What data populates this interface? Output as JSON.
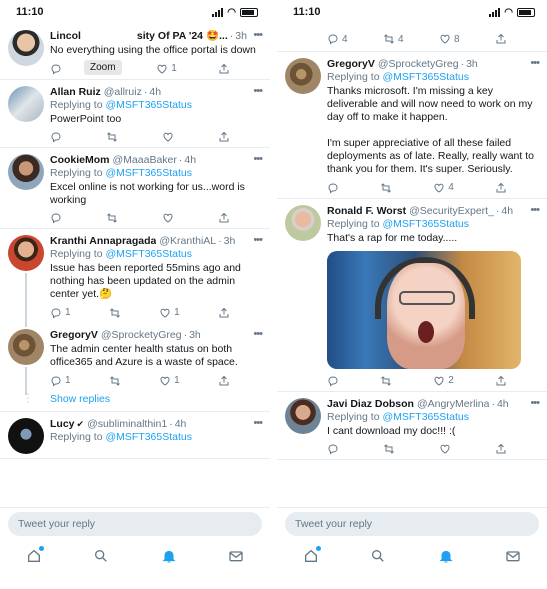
{
  "colors": {
    "accent": "#1da1f2",
    "muted": "#657786",
    "border": "#e6ecf0"
  },
  "left": {
    "status": {
      "time": "11:10"
    },
    "zoom_label": "Zoom",
    "tweets": [
      {
        "name": "Lincol",
        "name_rest": "sity Of PA '24 🤩...",
        "time": "3h",
        "text": "No everything using the office portal is down",
        "reply_count": "",
        "retweet_count": "",
        "like_count": "1"
      },
      {
        "name": "Allan Ruiz",
        "handle": "@allruiz",
        "time": "4h",
        "replying_prefix": "Replying to",
        "replying_to": "@MSFT365Status",
        "text": "PowerPoint too"
      },
      {
        "name": "CookieMom",
        "handle": "@MaaaBaker",
        "time": "4h",
        "replying_prefix": "Replying to",
        "replying_to": "@MSFT365Status",
        "text": "Excel online is not working for us...word is working"
      },
      {
        "name": "Kranthi Annapragada",
        "handle": "@KranthiAL",
        "time": "3h",
        "replying_prefix": "Replying to",
        "replying_to": "@MSFT365Status",
        "text": "Issue has been reported 55mins ago and nothing has been updated on the admin center yet.🤔",
        "reply_count": "1",
        "like_count": "1"
      },
      {
        "name": "GregoryV",
        "handle": "@SprocketyGreg",
        "time": "3h",
        "text": "The admin center health status on both office365 and Azure is a waste of space.",
        "reply_count": "1",
        "like_count": "1"
      },
      {
        "name": "Lucy",
        "handle": "@subliminalthin1",
        "time": "4h",
        "replying_prefix": "Replying to",
        "replying_to": "@MSFT365Status"
      }
    ],
    "show_replies": "Show replies",
    "composer_placeholder": "Tweet your reply"
  },
  "right": {
    "status": {
      "time": "11:10"
    },
    "top_actions": {
      "reply_count": "4",
      "retweet_count": "4",
      "like_count": "8"
    },
    "tweets": [
      {
        "name": "GregoryV",
        "handle": "@SprocketyGreg",
        "time": "3h",
        "replying_prefix": "Replying to",
        "replying_to": "@MSFT365Status",
        "text": "Thanks microsoft.  I'm missing a key deliverable and will now need to work on my day off to make it happen.\n\nI'm super appreciative of all these failed deployments as of late.  Really, really want to thank you for them.  It's super. Seriously.",
        "like_count": "4"
      },
      {
        "name": "Ronald F. Worst",
        "handle": "@SecurityExpert_",
        "time": "4h",
        "replying_prefix": "Replying to",
        "replying_to": "@MSFT365Status",
        "text": "That's a rap for me today.....",
        "like_count": "2"
      },
      {
        "name": "Javi Diaz Dobson",
        "handle": "@AngryMerlina",
        "time": "4h",
        "replying_prefix": "Replying to",
        "replying_to": "@MSFT365Status",
        "text": "I cant download my doc!!! :("
      }
    ],
    "composer_placeholder": "Tweet your reply"
  },
  "icons": [
    "home-icon",
    "search-icon",
    "bell-icon",
    "mail-icon",
    "reply-icon",
    "retweet-icon",
    "like-icon",
    "share-icon",
    "more-icon"
  ]
}
